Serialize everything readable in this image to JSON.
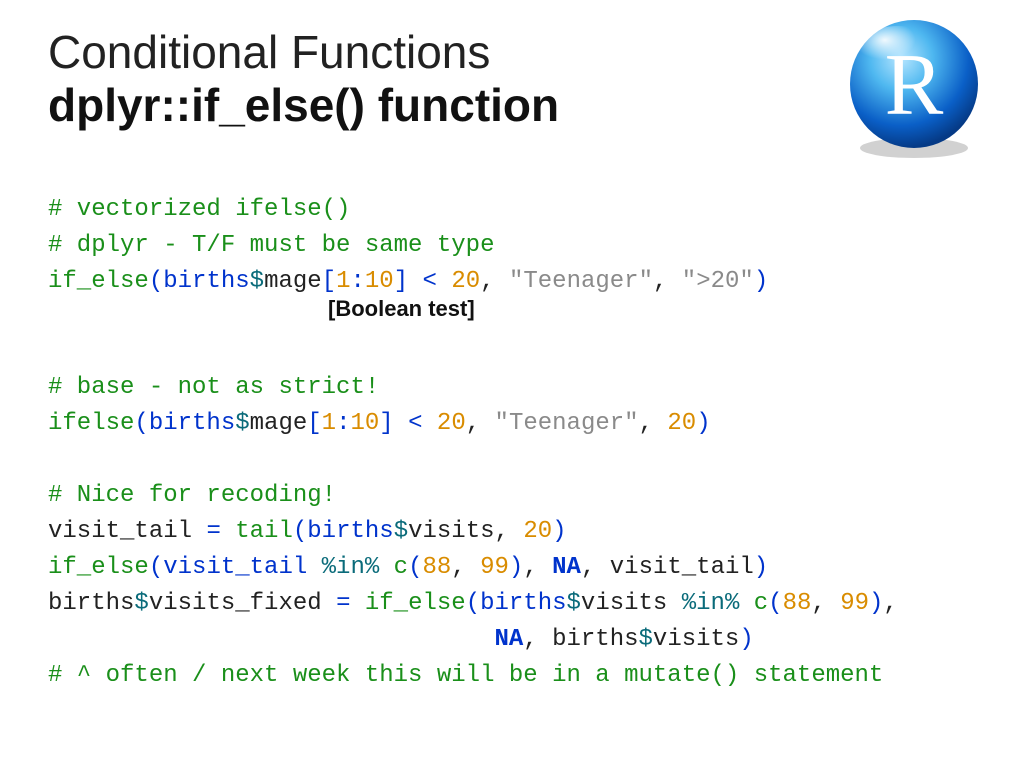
{
  "title_light": "Conditional Functions",
  "title_bold": "dplyr::if_else() function",
  "logo_letter": "R",
  "code": {
    "c1": "# vectorized ifelse()",
    "c2": "# dplyr - T/F must be same type",
    "l3_fn": "if_else",
    "l3_a": "(births",
    "l3_dol": "$",
    "l3_b": "mage",
    "l3_lb": "[",
    "l3_n1": "1",
    "l3_colon": ":",
    "l3_n2": "10",
    "l3_rb": "] ",
    "l3_lt": "<",
    "l3_sp": " ",
    "l3_n3": "20",
    "l3_com": ", ",
    "l3_s1": "\"Teenager\"",
    "l3_com2": ", ",
    "l3_s2": "\">20\"",
    "l3_rp": ")",
    "annot": "[Boolean test]",
    "c4": "# base - not as strict!",
    "l5_fn": "ifelse",
    "l5_a": "(births",
    "l5_dol": "$",
    "l5_b": "mage",
    "l5_lb": "[",
    "l5_n1": "1",
    "l5_colon": ":",
    "l5_n2": "10",
    "l5_rb": "] ",
    "l5_lt": "<",
    "l5_n3": "20",
    "l5_s1": "\"Teenager\"",
    "l5_n4": "20",
    "l5_rp": ")",
    "c6": "# Nice for recoding!",
    "l7_a": "visit_tail ",
    "l7_eq": "=",
    "l7_fn": " tail",
    "l7_b": "(births",
    "l7_dol": "$",
    "l7_c": "visits, ",
    "l7_n": "20",
    "l7_rp": ")",
    "l8_fn": "if_else",
    "l8_a": "(visit_tail ",
    "l8_in": "%in%",
    "l8_c": " c",
    "l8_lp": "(",
    "l8_n1": "88",
    "l8_com": ", ",
    "l8_n2": "99",
    "l8_rp": ")",
    "l8_com2": ", ",
    "l8_na": "NA",
    "l8_com3": ", visit_tail",
    "l8_rp2": ")",
    "l9_a": "births",
    "l9_dol": "$",
    "l9_b": "visits_fixed ",
    "l9_eq": "=",
    "l9_fn": " if_else",
    "l9_c": "(births",
    "l9_dol2": "$",
    "l9_d": "visits ",
    "l9_in": "%in%",
    "l9_cc": " c",
    "l9_lp": "(",
    "l9_n1": "88",
    "l9_com": ", ",
    "l9_n2": "99",
    "l9_rp": ")",
    "l9_com2": ",",
    "l10_pad": "                               ",
    "l10_na": "NA",
    "l10_a": ", births",
    "l10_dol": "$",
    "l10_b": "visits",
    "l10_rp": ")",
    "c11": "# ^ often / next week this will be in a mutate() statement"
  }
}
